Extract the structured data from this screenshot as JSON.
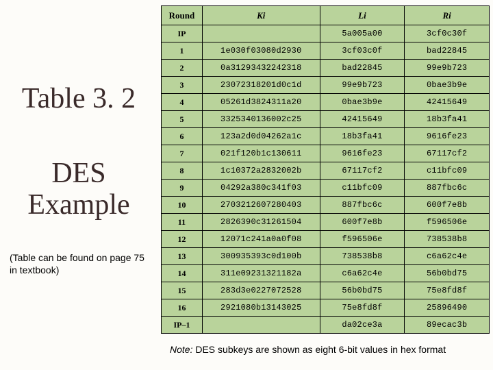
{
  "left": {
    "title_a": "Table 3. 2",
    "title_b": "DES Example",
    "subnote": "(Table can be found on page 75 in textbook)"
  },
  "table": {
    "headers": {
      "round": "Round",
      "ki": "Ki",
      "li": "Li",
      "ri": "Ri"
    },
    "rows": [
      {
        "round": "IP",
        "ki": "",
        "li": "5a005a00",
        "ri": "3cf0c30f"
      },
      {
        "round": "1",
        "ki": "1e030f03080d2930",
        "li": "3cf03c0f",
        "ri": "bad22845"
      },
      {
        "round": "2",
        "ki": "0a31293432242318",
        "li": "bad22845",
        "ri": "99e9b723"
      },
      {
        "round": "3",
        "ki": "23072318201d0c1d",
        "li": "99e9b723",
        "ri": "0bae3b9e"
      },
      {
        "round": "4",
        "ki": "05261d3824311a20",
        "li": "0bae3b9e",
        "ri": "42415649"
      },
      {
        "round": "5",
        "ki": "3325340136002c25",
        "li": "42415649",
        "ri": "18b3fa41"
      },
      {
        "round": "6",
        "ki": "123a2d0d04262a1c",
        "li": "18b3fa41",
        "ri": "9616fe23"
      },
      {
        "round": "7",
        "ki": "021f120b1c130611",
        "li": "9616fe23",
        "ri": "67117cf2"
      },
      {
        "round": "8",
        "ki": "1c10372a2832002b",
        "li": "67117cf2",
        "ri": "c11bfc09"
      },
      {
        "round": "9",
        "ki": "04292a380c341f03",
        "li": "c11bfc09",
        "ri": "887fbc6c"
      },
      {
        "round": "10",
        "ki": "2703212607280403",
        "li": "887fbc6c",
        "ri": "600f7e8b"
      },
      {
        "round": "11",
        "ki": "2826390c31261504",
        "li": "600f7e8b",
        "ri": "f596506e"
      },
      {
        "round": "12",
        "ki": "12071c241a0a0f08",
        "li": "f596506e",
        "ri": "738538b8"
      },
      {
        "round": "13",
        "ki": "300935393c0d100b",
        "li": "738538b8",
        "ri": "c6a62c4e"
      },
      {
        "round": "14",
        "ki": "311e09231321182a",
        "li": "c6a62c4e",
        "ri": "56b0bd75"
      },
      {
        "round": "15",
        "ki": "283d3e0227072528",
        "li": "56b0bd75",
        "ri": "75e8fd8f"
      },
      {
        "round": "16",
        "ki": "2921080b13143025",
        "li": "75e8fd8f",
        "ri": "25896490"
      },
      {
        "round": "IP–1",
        "ki": "",
        "li": "da02ce3a",
        "ri": "89ecac3b"
      }
    ]
  },
  "footnote": {
    "lead": "Note:",
    "text": " DES subkeys are shown as eight 6-bit values in hex format"
  }
}
